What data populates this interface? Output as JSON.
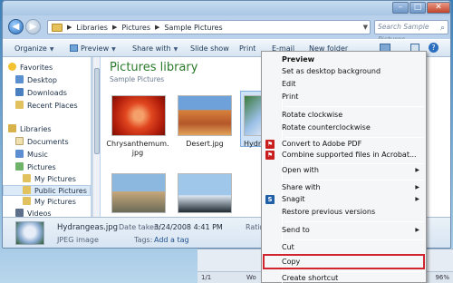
{
  "window": {
    "address": {
      "crumbs": [
        "Libraries",
        "Pictures",
        "Sample Pictures"
      ]
    },
    "search": {
      "placeholder": "Search Sample Pictures"
    }
  },
  "toolbar": {
    "organize": "Organize",
    "preview": "Preview",
    "share_with": "Share with",
    "slide_show": "Slide show",
    "print": "Print",
    "email": "E-mail",
    "new_folder": "New folder"
  },
  "nav": {
    "favorites": "Favorites",
    "desktop": "Desktop",
    "downloads": "Downloads",
    "recent": "Recent Places",
    "libraries": "Libraries",
    "documents": "Documents",
    "music": "Music",
    "pictures": "Pictures",
    "my_pictures": "My Pictures",
    "public_pictures": "Public Pictures",
    "my_pictures_2": "My Pictures",
    "videos": "Videos"
  },
  "content": {
    "title": "Pictures library",
    "subtitle": "Sample Pictures",
    "files": [
      {
        "name_line1": "Chrysanthemum.",
        "name_line2": "jpg"
      },
      {
        "name_line1": "Desert.jpg",
        "name_line2": ""
      },
      {
        "name_line1": "Hydra",
        "name_line2": ""
      }
    ]
  },
  "details": {
    "filename": "Hydrangeas.jpg",
    "date_label": "Date taken:",
    "date_value": "3/24/2008 4:41 PM",
    "type": "JPEG image",
    "tags_label": "Tags:",
    "tags_value": "Add a tag",
    "rating_label": "Ratin"
  },
  "background_window": {
    "status_left": "1/1",
    "status_words": "Wo",
    "zoom": "96%"
  },
  "context_menu": {
    "preview": "Preview",
    "set_desktop": "Set as desktop background",
    "edit": "Edit",
    "print": "Print",
    "rotate_cw": "Rotate clockwise",
    "rotate_ccw": "Rotate counterclockwise",
    "convert_pdf": "Convert to Adobe PDF",
    "combine": "Combine supported files in Acrobat...",
    "open_with": "Open with",
    "share_with": "Share with",
    "snagit": "Snagit",
    "restore": "Restore previous versions",
    "send_to": "Send to",
    "cut": "Cut",
    "copy": "Copy",
    "create_shortcut": "Create shortcut"
  },
  "colors": {
    "library_title": "#2b7a2b",
    "copy_highlight": "#d0252e"
  }
}
